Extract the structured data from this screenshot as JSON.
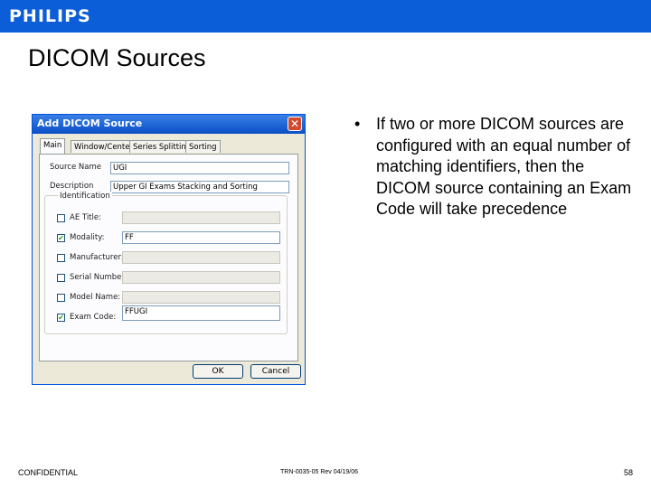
{
  "header": {
    "logo": "PHILIPS",
    "bar_color": "#0b5ed7"
  },
  "slide": {
    "title": "DICOM Sources"
  },
  "dialog": {
    "title": "Add DICOM Source",
    "close_glyph": "✕",
    "tabs": [
      "Main",
      "Window/Center",
      "Series Splitting",
      "Sorting"
    ],
    "active_tab": "Main",
    "source_name_label": "Source Name",
    "source_name_value": "UGI",
    "description_label": "Description",
    "description_value": "Upper GI Exams Stacking and Sorting",
    "identification_label": "Identification",
    "identifiers": [
      {
        "label": "AE Title:",
        "checked": false,
        "value": ""
      },
      {
        "label": "Modality:",
        "checked": true,
        "value": "FF"
      },
      {
        "label": "Manufacturer:",
        "checked": false,
        "value": ""
      },
      {
        "label": "Serial Number:",
        "checked": false,
        "value": ""
      },
      {
        "label": "Model Name:",
        "checked": false,
        "value": ""
      },
      {
        "label": "Exam Code:",
        "checked": true,
        "value": "FFUGI"
      }
    ],
    "ok_label": "OK",
    "cancel_label": "Cancel"
  },
  "bullet": {
    "marker": "•",
    "text": "If two or more DICOM sources are configured with an equal number of matching identifiers, then the DICOM source containing an Exam Code will take precedence"
  },
  "footer": {
    "left": "CONFIDENTIAL",
    "center": "TRN-0035-05 Rev 04/19/06",
    "page": "58"
  }
}
